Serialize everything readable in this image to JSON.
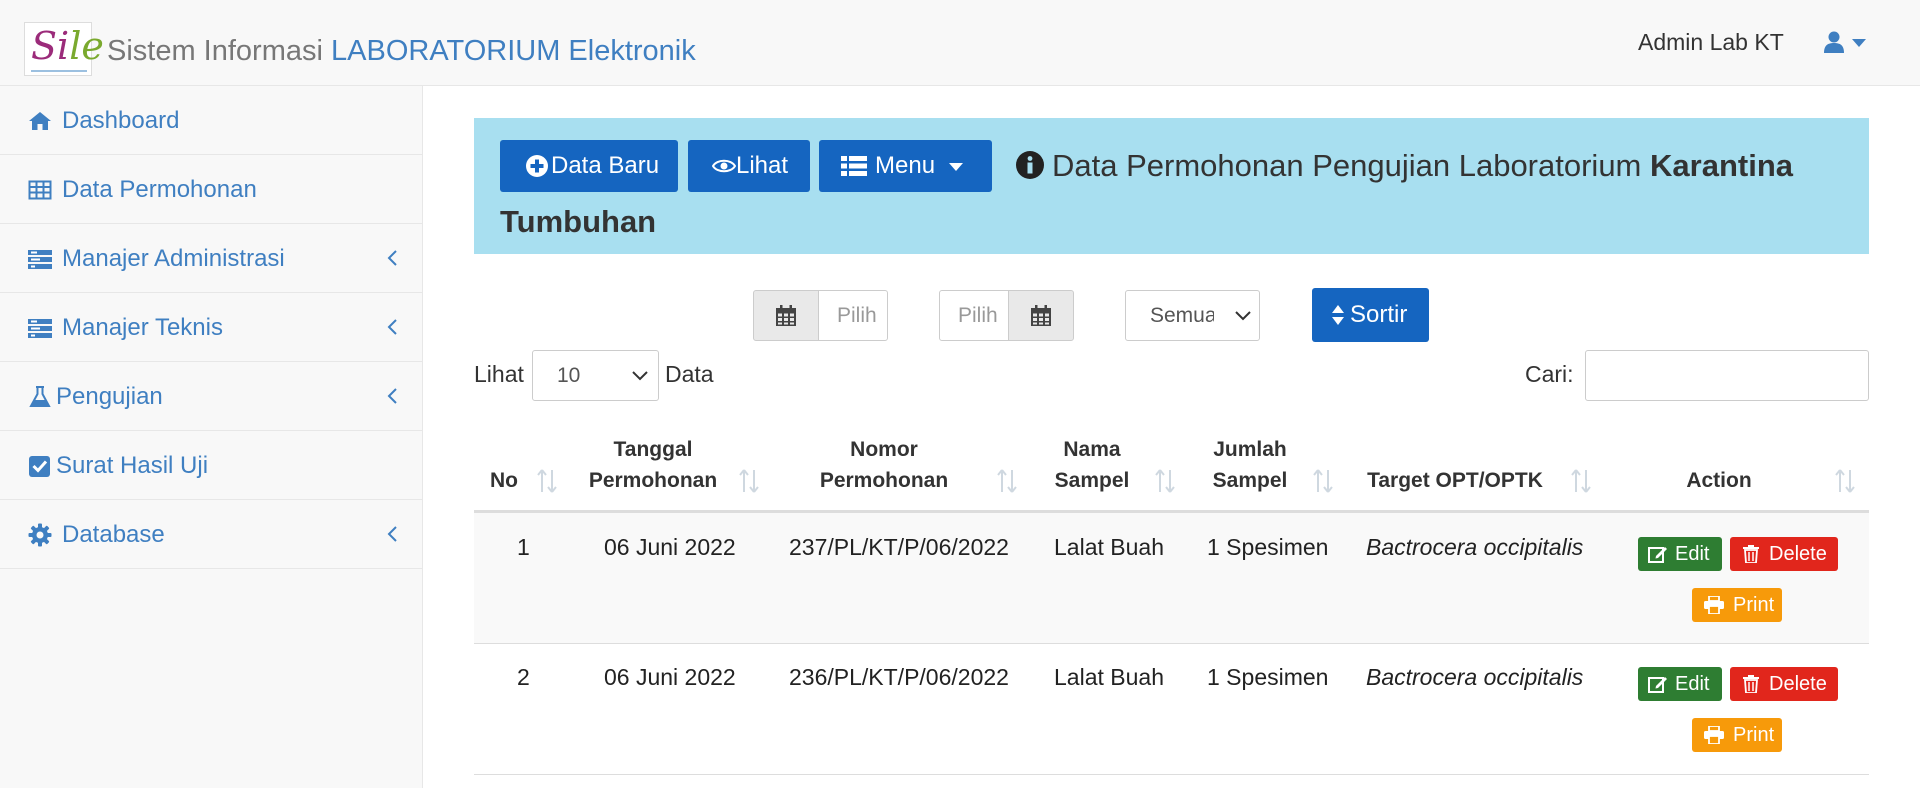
{
  "app": {
    "logo_text_a": "Si",
    "logo_text_b": "le",
    "brand_prefix": "Sistem Informasi",
    "brand_accent": "LABORATORIUM Elektronik",
    "user_name": "Admin Lab KT"
  },
  "sidebar": {
    "items": [
      {
        "label": "Dashboard",
        "icon": "home-icon",
        "has_submenu": false
      },
      {
        "label": "Data Permohonan",
        "icon": "table-icon",
        "has_submenu": false
      },
      {
        "label": "Manajer Administrasi",
        "icon": "tasks-icon",
        "has_submenu": true
      },
      {
        "label": "Manajer Teknis",
        "icon": "tasks-icon",
        "has_submenu": true
      },
      {
        "label": "Pengujian",
        "icon": "flask-icon",
        "has_submenu": true
      },
      {
        "label": "Surat Hasil Uji",
        "icon": "check-square-icon",
        "has_submenu": false
      },
      {
        "label": "Database",
        "icon": "gear-icon",
        "has_submenu": true
      }
    ]
  },
  "header": {
    "btn_new": "Data Baru",
    "btn_view": "Lihat",
    "btn_menu": "Menu",
    "title_normal": "Data Permohonan Pengujian Laboratorium",
    "title_bold_1": "Karantina",
    "title_bold_2": "Tumbuhan"
  },
  "filters": {
    "date_from_placeholder": "Pilih",
    "date_to_placeholder": "Pilih",
    "status_selected": "Semua",
    "sort_button": "Sortir"
  },
  "table_controls": {
    "show_label": "Lihat",
    "page_size": "10",
    "data_label": "Data",
    "search_label": "Cari:",
    "search_value": ""
  },
  "table": {
    "columns": [
      {
        "line1": "No",
        "line2": ""
      },
      {
        "line1": "Tanggal",
        "line2": "Permohonan"
      },
      {
        "line1": "Nomor",
        "line2": "Permohonan"
      },
      {
        "line1": "Nama",
        "line2": "Sampel"
      },
      {
        "line1": "Jumlah",
        "line2": "Sampel"
      },
      {
        "line1": "Target OPT/OPTK",
        "line2": ""
      },
      {
        "line1": "Action",
        "line2": ""
      }
    ],
    "rows": [
      {
        "no": "1",
        "tanggal": "06 Juni 2022",
        "nomor": "237/PL/KT/P/06/2022",
        "nama": "Lalat Buah",
        "jumlah": "1 Spesimen",
        "target": "Bactrocera occipitalis"
      },
      {
        "no": "2",
        "tanggal": "06 Juni 2022",
        "nomor": "236/PL/KT/P/06/2022",
        "nama": "Lalat Buah",
        "jumlah": "1 Spesimen",
        "target": "Bactrocera occipitalis"
      }
    ],
    "actions": {
      "edit": "Edit",
      "delete": "Delete",
      "print": "Print"
    }
  },
  "colors": {
    "primary": "#1565c0",
    "header_bg": "#a8dff0",
    "link": "#3f7fc1",
    "edit": "#2e7d32",
    "delete": "#e1261c",
    "print": "#f79a0a"
  }
}
